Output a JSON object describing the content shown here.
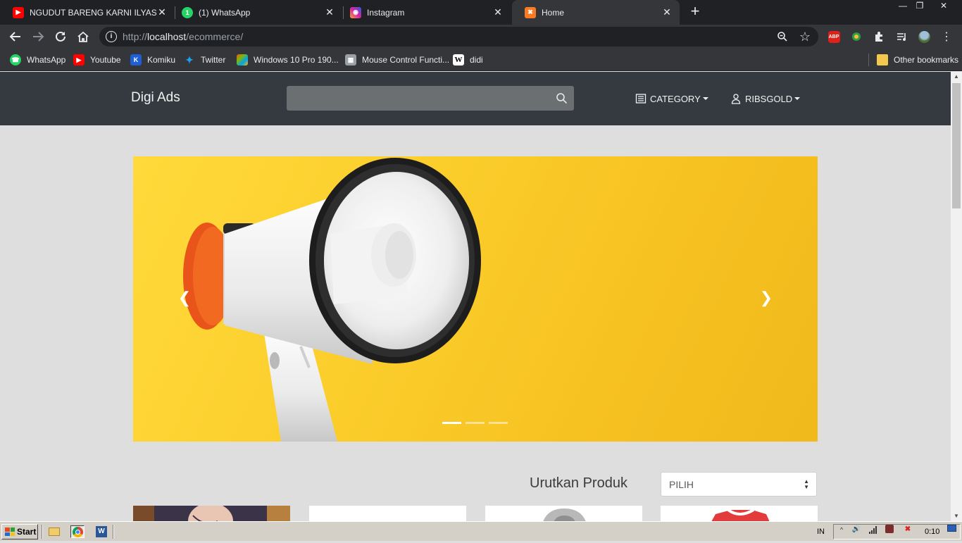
{
  "browser": {
    "tabs": [
      {
        "title": "NGUDUT BARENG KARNI ILYAS☐ (",
        "icon": "youtube-icon",
        "active": false
      },
      {
        "title": "(1) WhatsApp",
        "icon": "whatsapp-icon",
        "active": false
      },
      {
        "title": "Instagram",
        "icon": "instagram-icon",
        "active": false
      },
      {
        "title": "Home",
        "icon": "xampp-icon",
        "active": true
      }
    ],
    "address": {
      "scheme": "http://",
      "host": "localhost",
      "path": "/ecommerce/"
    },
    "bookmarks": [
      {
        "label": "WhatsApp",
        "icon": "whatsapp-icon"
      },
      {
        "label": "Youtube",
        "icon": "youtube-icon"
      },
      {
        "label": "Komiku",
        "icon": "komiku-icon"
      },
      {
        "label": "Twitter",
        "icon": "twitter-icon"
      },
      {
        "label": "Windows 10 Pro 190...",
        "icon": "windows-icon"
      },
      {
        "label": "Mouse Control Functi...",
        "icon": "page-icon"
      },
      {
        "label": "didi",
        "icon": "wikipedia-icon"
      }
    ],
    "other_bookmarks": "Other bookmarks",
    "extensions": {
      "abp": "ABP"
    }
  },
  "site": {
    "brand": "Digi Ads",
    "search": {
      "placeholder": "",
      "value": ""
    },
    "nav": {
      "category": "CATEGORY",
      "user": "RIBSGOLD"
    },
    "carousel": {
      "slide_count": 3,
      "active_index": 0
    },
    "sort": {
      "label": "Urutkan Produk",
      "selected": "PILIH"
    }
  },
  "taskbar": {
    "start": "Start",
    "language": "IN",
    "clock": "0:10",
    "quicklaunch": [
      "folder-icon",
      "chrome-icon",
      "word-icon"
    ]
  }
}
